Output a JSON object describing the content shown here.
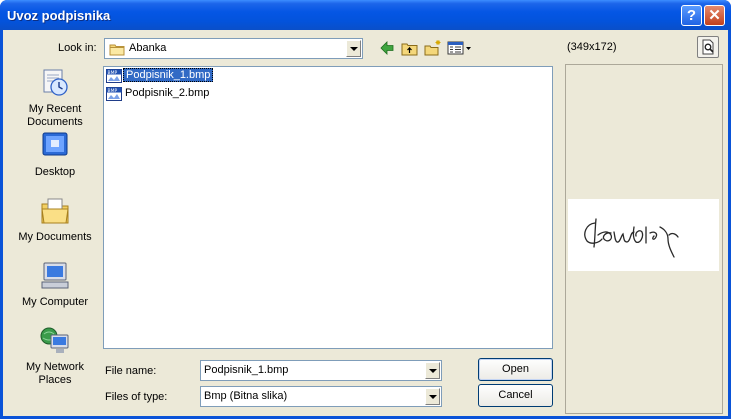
{
  "window": {
    "title": "Uvoz podpisnika",
    "buttons": [
      "help-icon",
      "close-icon"
    ],
    "colors": {
      "titlebar": "#0556e4",
      "client": "#ece9d8",
      "selection": "#316ac5"
    }
  },
  "lookin": {
    "label": "Look in:",
    "value": "Abanka",
    "icon": "folder-icon"
  },
  "toolbar": {
    "icons": [
      "back-arrow-icon",
      "up-folder-icon",
      "new-folder-icon",
      "view-menu-icon"
    ]
  },
  "preview": {
    "size_text": "(349x172)",
    "toggle_icon": "preview-icon"
  },
  "places": [
    {
      "label_line1": "My Recent",
      "label_line2": "Documents",
      "icon": "recent-documents-icon"
    },
    {
      "label_line1": "Desktop",
      "label_line2": "",
      "icon": "desktop-icon"
    },
    {
      "label_line1": "My Documents",
      "label_line2": "",
      "icon": "my-documents-icon"
    },
    {
      "label_line1": "My Computer",
      "label_line2": "",
      "icon": "my-computer-icon"
    },
    {
      "label_line1": "My Network",
      "label_line2": "Places",
      "icon": "network-places-icon"
    }
  ],
  "files": [
    {
      "name": "Podpisnik_1.bmp",
      "selected": true,
      "icon": "bmp-file-icon"
    },
    {
      "name": "Podpisnik_2.bmp",
      "selected": false,
      "icon": "bmp-file-icon"
    }
  ],
  "filename": {
    "label": "File name:",
    "value": "Podpisnik_1.bmp"
  },
  "filetype": {
    "label": "Files of type:",
    "value": "Bmp (Bitna slika)"
  },
  "actions": {
    "open": "Open",
    "cancel": "Cancel"
  }
}
